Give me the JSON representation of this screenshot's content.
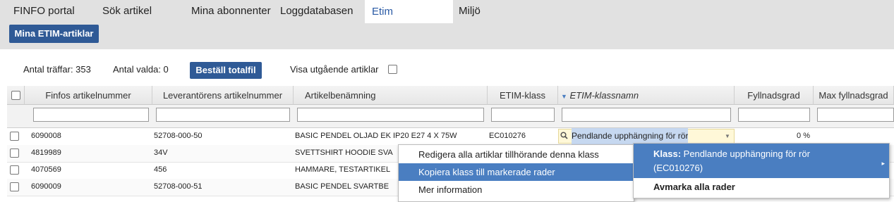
{
  "nav": {
    "items": [
      "FINFO portal",
      "Sök artikel",
      "Mina abonnenter",
      "Loggdatabasen",
      "Etim",
      "Miljö"
    ],
    "sub_button": "Mina ETIM-artiklar"
  },
  "toolbar": {
    "hits": "Antal träffar: 353",
    "selected": "Antal valda: 0",
    "order_button": "Beställ totalfil",
    "show_outgoing": "Visa utgående artiklar"
  },
  "table": {
    "columns": [
      "Finfos artikelnummer",
      "Leverantörens artikelnummer",
      "Artikelbenämning",
      "ETIM-klass",
      "ETIM-klassnamn",
      "Fyllnadsgrad",
      "Max fyllnadsgrad"
    ],
    "rows": [
      {
        "finfo": "6090008",
        "supplier": "52708-000-50",
        "name": "BASIC PENDEL OLJAD EK IP20 E27 4 X 75W",
        "etim": "EC010276",
        "klassnamn": "Pendlande upphängning för rör",
        "fill": "0 %"
      },
      {
        "finfo": "4819989",
        "supplier": "34V",
        "name": "SVETTSHIRT HOODIE SVA",
        "etim": "",
        "klassnamn": "",
        "fill": ""
      },
      {
        "finfo": "4070569",
        "supplier": "456",
        "name": "HAMMARE, TESTARTIKEL",
        "etim": "",
        "klassnamn": "",
        "fill": ""
      },
      {
        "finfo": "6090009",
        "supplier": "52708-000-51",
        "name": "BASIC PENDEL SVARTBE",
        "etim": "",
        "klassnamn": "",
        "fill": ""
      }
    ]
  },
  "context_menu": {
    "items": [
      "Redigera alla artiklar tillhörande denna klass",
      "Kopiera klass till markerade rader",
      "Mer information"
    ],
    "highlighted": 1
  },
  "submenu": {
    "class_label": "Klass:",
    "class_value": "Pendlande upphängning för rör",
    "class_code": "(EC010276)",
    "unmark": "Avmarka alla rader"
  },
  "colors": {
    "accent": "#2f5a96",
    "highlight": "#4a7ec1"
  }
}
